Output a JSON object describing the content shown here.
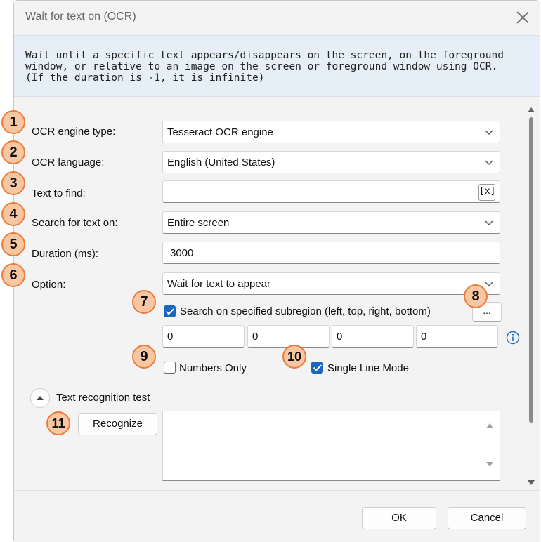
{
  "window": {
    "title": "Wait for text on (OCR)",
    "description": "Wait until a specific text appears/disappears on the screen, on the foreground\nwindow, or relative to an image on the screen or foreground window using OCR.\n(If the duration is -1, it is infinite)"
  },
  "form": {
    "engine_label": "OCR engine type:",
    "engine_value": "Tesseract OCR engine",
    "language_label": "OCR language:",
    "language_value": "English (United States)",
    "text_label": "Text to find:",
    "text_value": "",
    "var_button": "[x]",
    "search_label": "Search for text on:",
    "search_value": "Entire screen",
    "duration_label": "Duration (ms):",
    "duration_value": "3000",
    "option_label": "Option:",
    "option_value": "Wait for text to appear",
    "subregion_label": "Search on specified subregion (left, top, right, bottom)",
    "subregion_checked": true,
    "subregion_button": "...",
    "subregion_values": [
      "0",
      "0",
      "0",
      "0"
    ],
    "numbers_only_label": "Numbers Only",
    "numbers_only_checked": false,
    "single_line_label": "Single Line Mode",
    "single_line_checked": true,
    "recognition_section": "Text recognition test",
    "recognize_button": "Recognize",
    "recognition_output": ""
  },
  "badges": [
    "1",
    "2",
    "3",
    "4",
    "5",
    "6",
    "7",
    "8",
    "9",
    "10",
    "11"
  ],
  "footer": {
    "ok": "OK",
    "cancel": "Cancel"
  },
  "colors": {
    "accent": "#1867c0",
    "badge_fill": "#f7c7a4",
    "badge_border": "#ec7c3a",
    "info": "#1e6fd0"
  }
}
